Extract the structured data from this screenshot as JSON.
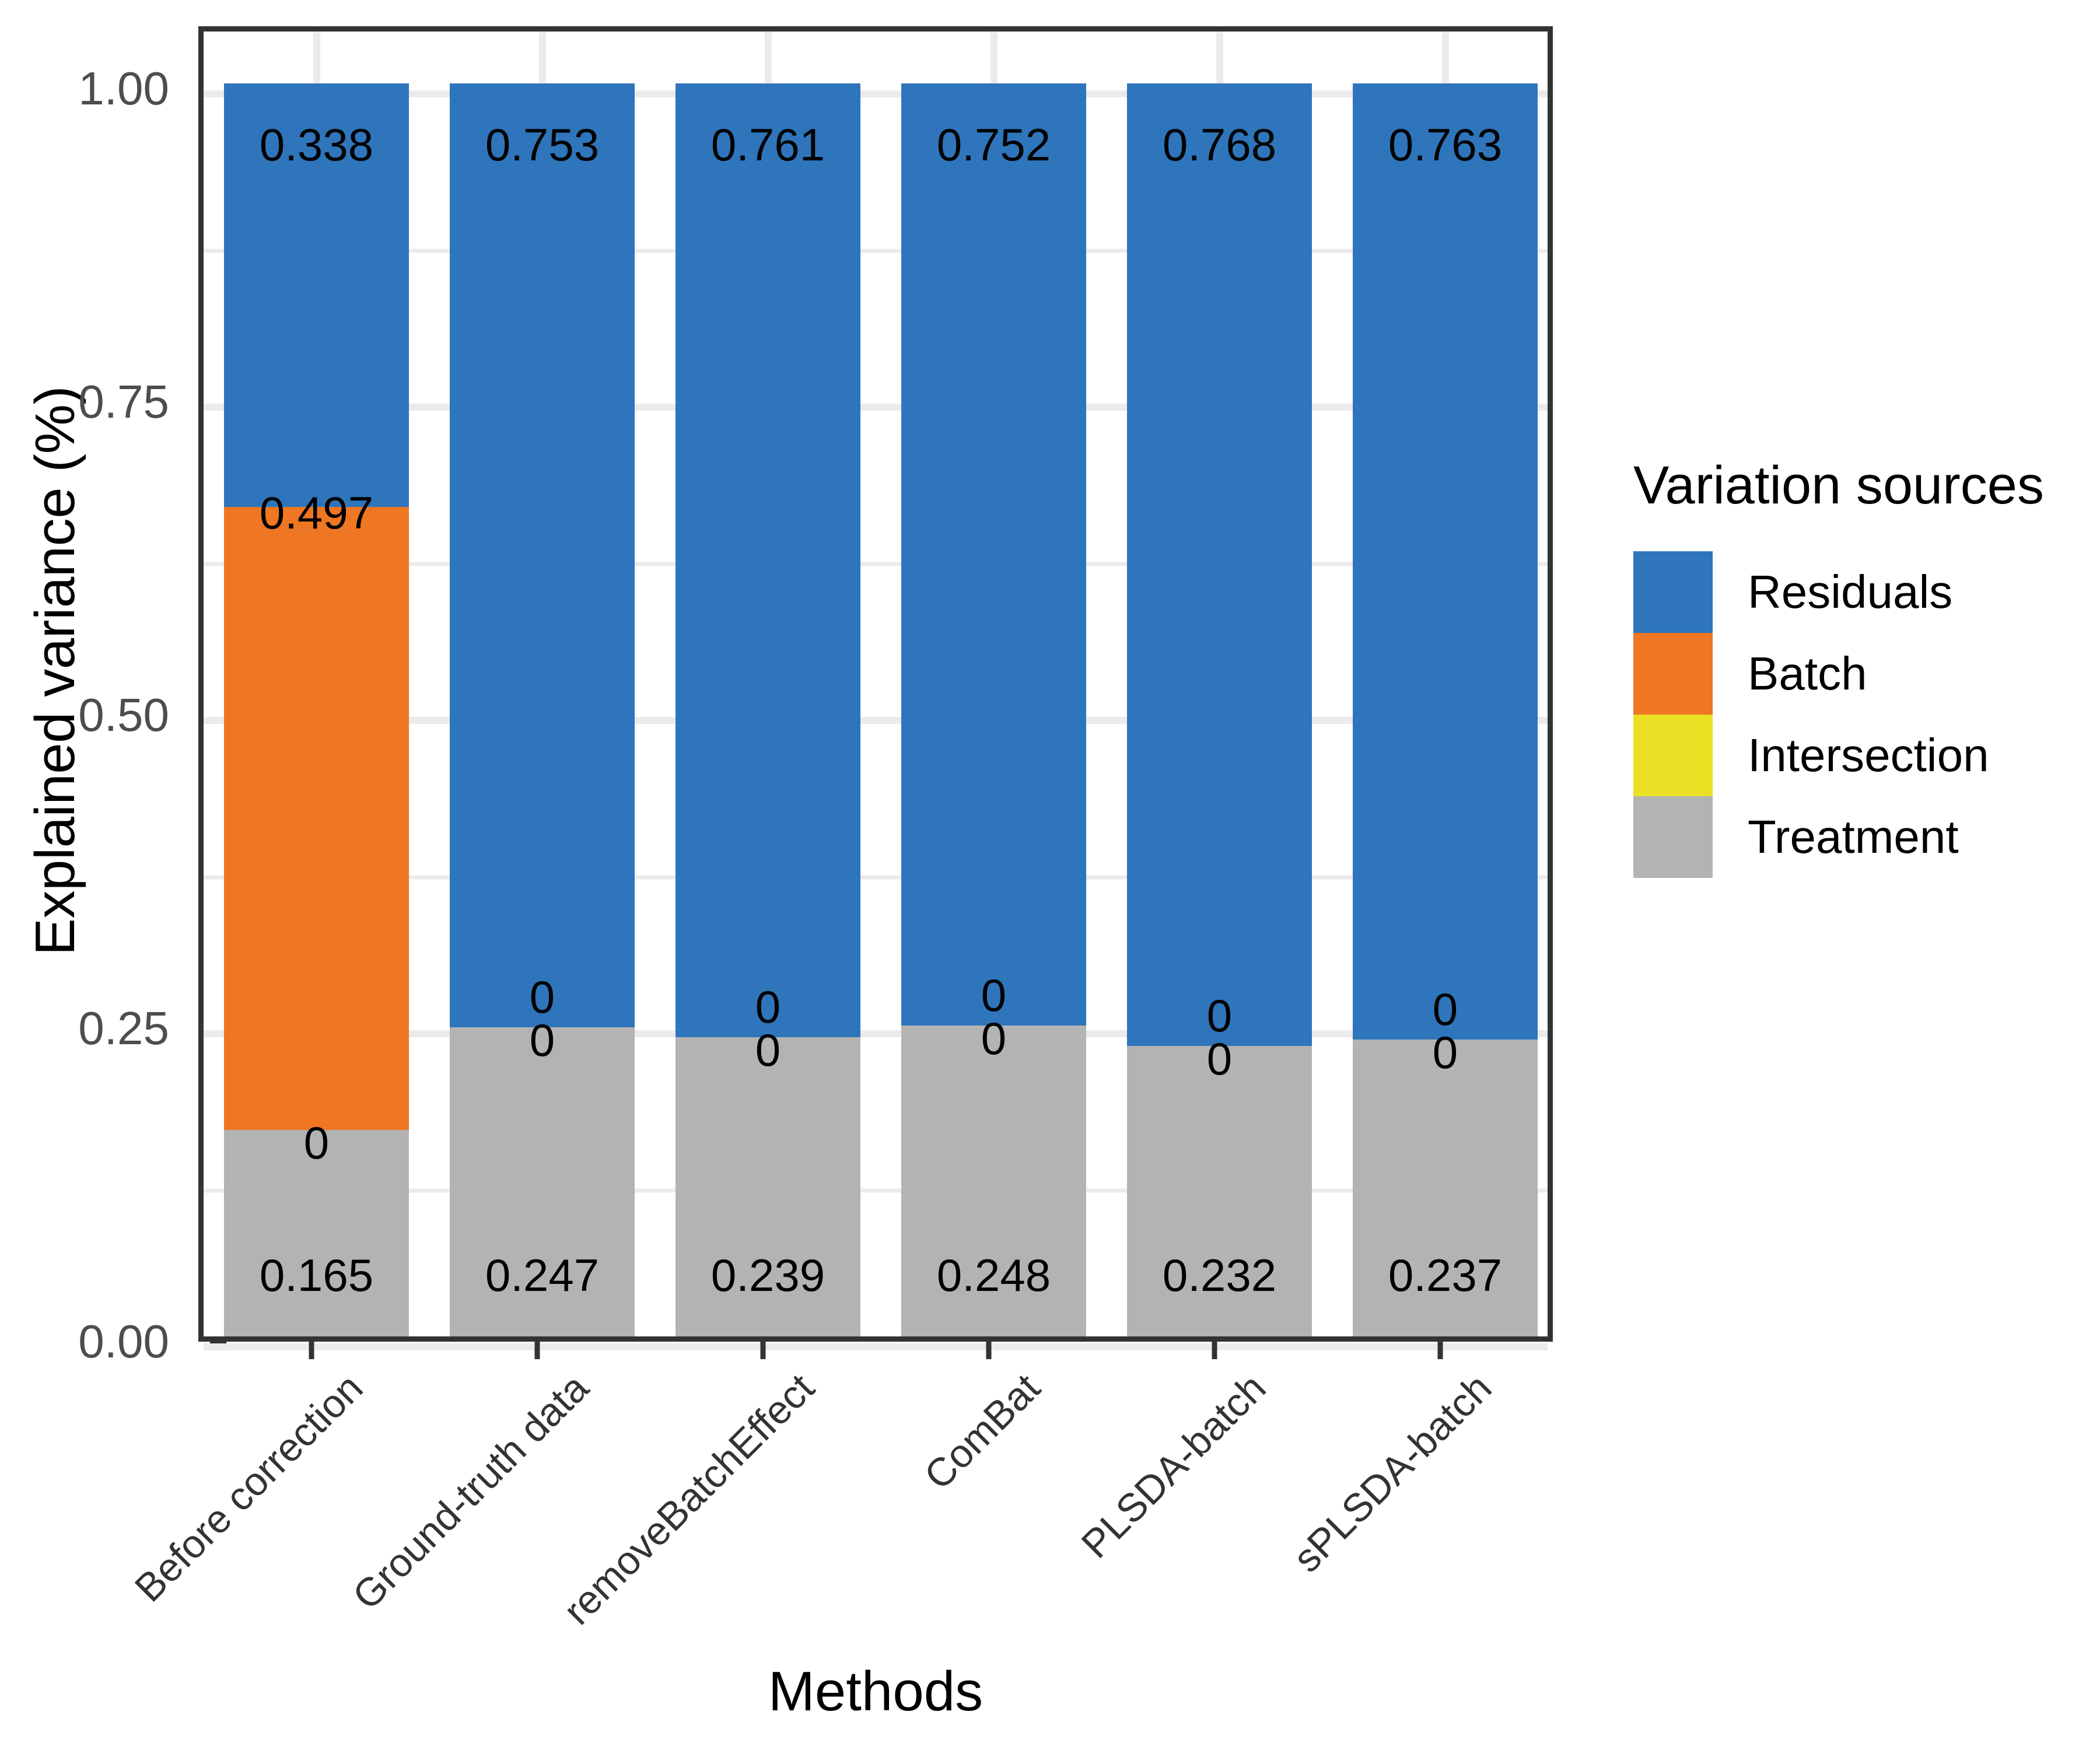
{
  "chart_data": {
    "type": "bar",
    "subtype": "stacked-bar",
    "title": "",
    "xlabel": "Methods",
    "ylabel": "Explained variance (%)",
    "ylim": [
      0,
      1.05
    ],
    "y_ticks": [
      "0.00",
      "0.25",
      "0.50",
      "0.75",
      "1.00"
    ],
    "y_tick_values": [
      0.0,
      0.25,
      0.5,
      0.75,
      1.0
    ],
    "y_minor_ticks": [
      0.125,
      0.375,
      0.625,
      0.875
    ],
    "grid": true,
    "legend_position": "right",
    "legend_title": "Variation sources",
    "categories": [
      "Before correction",
      "Ground-truth data",
      "removeBatchEffect",
      "ComBat",
      "PLSDA-batch",
      "sPLSDA-batch"
    ],
    "series": [
      {
        "name": "Residuals",
        "color": "#2e75bb",
        "values": [
          0.338,
          0.753,
          0.761,
          0.752,
          0.768,
          0.763
        ],
        "labels": [
          "0.338",
          "0.753",
          "0.761",
          "0.752",
          "0.768",
          "0.763"
        ]
      },
      {
        "name": "Batch",
        "color": "#ef7622",
        "values": [
          0.497,
          0.0,
          0.0,
          0.0,
          0.0,
          0.0
        ],
        "labels": [
          "0.497",
          "0",
          "0",
          "0",
          "0",
          "0"
        ]
      },
      {
        "name": "Intersection",
        "color": "#ebe024",
        "values": [
          0.0,
          0.0,
          0.0,
          0.0,
          0.0,
          0.0
        ],
        "labels": [
          "0",
          "0",
          "0",
          "0",
          "0",
          "0"
        ]
      },
      {
        "name": "Treatment",
        "color": "#b3b3b3",
        "values": [
          0.165,
          0.247,
          0.239,
          0.248,
          0.232,
          0.237
        ],
        "labels": [
          "0.165",
          "0.247",
          "0.239",
          "0.248",
          "0.232",
          "0.237"
        ]
      }
    ]
  },
  "axes": {
    "y_title": "Explained variance (%)",
    "x_title": "Methods"
  },
  "legend": {
    "title": "Variation sources",
    "items": [
      {
        "label": "Residuals",
        "color": "#2e75bb"
      },
      {
        "label": "Batch",
        "color": "#ef7622"
      },
      {
        "label": "Intersection",
        "color": "#ebe024"
      },
      {
        "label": "Treatment",
        "color": "#b3b3b3"
      }
    ]
  },
  "colors": {
    "residuals": "#2e75bb",
    "batch": "#ef7622",
    "intersection": "#ebe024",
    "treatment": "#b3b3b3",
    "grid": "#ebebeb",
    "axis": "#333333",
    "background": "#ffffff"
  }
}
